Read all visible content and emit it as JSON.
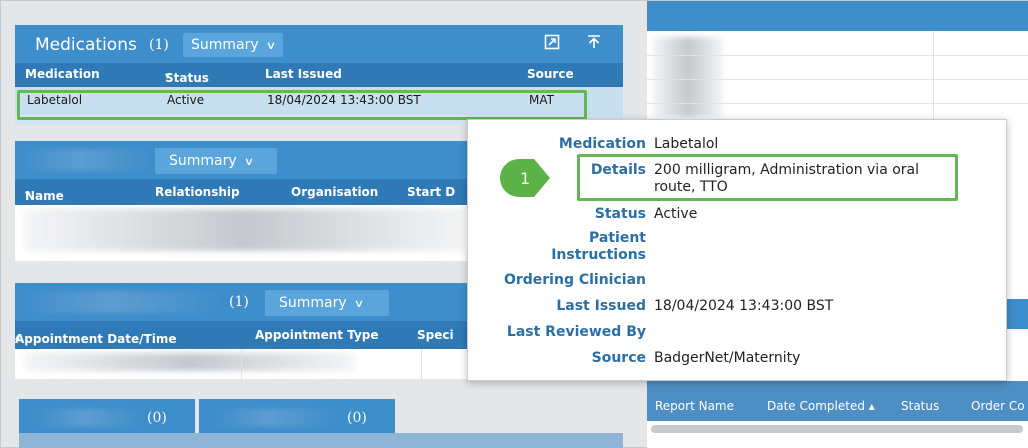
{
  "medications": {
    "title": "Medications",
    "count": "(1)",
    "summary_label": "Summary",
    "columns": [
      "Medication",
      "Status",
      "Last Issued",
      "Source"
    ],
    "status_sort": "▾",
    "row": {
      "medication": "Labetalol",
      "status": "Active",
      "last_issued": "18/04/2024 13:43:00 BST",
      "source": "MAT"
    }
  },
  "relationships": {
    "summary_label": "Summary",
    "columns": [
      "Name",
      "Relationship",
      "Organisation",
      "Start D"
    ],
    "name_sort": "▾"
  },
  "appointments": {
    "count": "(1)",
    "summary_label": "Summary",
    "columns": [
      "Appointment Date/Time",
      "Appointment Type",
      "Speci"
    ],
    "date_sort": "▴"
  },
  "bottom_tabs": {
    "tab1_count": "(0)",
    "tab2_count": "(0)"
  },
  "reports": {
    "columns": [
      "Report Name",
      "Date Completed",
      "Status",
      "Order Co"
    ],
    "date_sort": "▴"
  },
  "popup": {
    "rows": [
      {
        "label": "Medication",
        "value": "Labetalol"
      },
      {
        "label": "Details",
        "value": "200 milligram, Administration via oral route, TTO"
      },
      {
        "label": "Status",
        "value": "Active"
      },
      {
        "label": "Patient Instructions",
        "value": ""
      },
      {
        "label": "Ordering Clinician",
        "value": ""
      },
      {
        "label": "Last Issued",
        "value": "18/04/2024 13:43:00 BST"
      },
      {
        "label": "Last Reviewed By",
        "value": ""
      },
      {
        "label": "Source",
        "value": "BadgerNet/Maternity"
      }
    ]
  },
  "callout": {
    "number": "1"
  },
  "colors": {
    "header": "#3e8ecb",
    "subheader": "#2f7ab6",
    "label": "#2c6fa5",
    "highlight": "#63b755"
  }
}
